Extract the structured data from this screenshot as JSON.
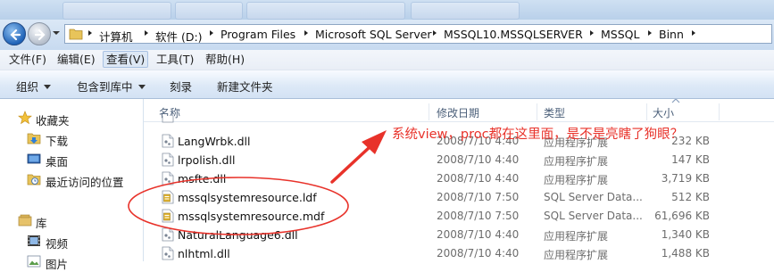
{
  "address": {
    "segments": [
      "计算机",
      "软件 (D:)",
      "Program Files",
      "Microsoft SQL Server",
      "MSSQL10.MSSQLSERVER",
      "MSSQL",
      "Binn"
    ]
  },
  "menu": [
    "文件(F)",
    "编辑(E)",
    "查看(V)",
    "工具(T)",
    "帮助(H)"
  ],
  "menu_active": "查看(V)",
  "toolbar": {
    "organize": "组织",
    "include_library": "包含到库中",
    "burn": "刻录",
    "new_folder": "新建文件夹"
  },
  "nav": {
    "favorites": "收藏夹",
    "downloads": "下载",
    "desktop": "桌面",
    "recent": "最近访问的位置",
    "libraries": "库",
    "videos": "视频",
    "pictures": "图片"
  },
  "columns": {
    "name": "名称",
    "modified": "修改日期",
    "type": "类型",
    "size": "大小"
  },
  "files": [
    {
      "name": "LangWrbk.dll",
      "date": "2008/7/10 4:40",
      "type": "应用程序扩展",
      "size": "232 KB",
      "icon": "dll-file-icon"
    },
    {
      "name": "lrpolish.dll",
      "date": "2008/7/10 4:40",
      "type": "应用程序扩展",
      "size": "147 KB",
      "icon": "dll-file-icon"
    },
    {
      "name": "msfte.dll",
      "date": "2008/7/10 4:40",
      "type": "应用程序扩展",
      "size": "3,719 KB",
      "icon": "dll-file-icon"
    },
    {
      "name": "mssqlsystemresource.ldf",
      "date": "2008/7/10 7:50",
      "type": "SQL Server Data...",
      "size": "512 KB",
      "icon": "sql-data-file-icon"
    },
    {
      "name": "mssqlsystemresource.mdf",
      "date": "2008/7/10 7:50",
      "type": "SQL Server Data...",
      "size": "61,696 KB",
      "icon": "sql-data-file-icon"
    },
    {
      "name": "NaturalLanguage6.dll",
      "date": "2008/7/10 4:40",
      "type": "应用程序扩展",
      "size": "1,340 KB",
      "icon": "dll-file-icon"
    },
    {
      "name": "nlhtml.dll",
      "date": "2008/7/10 4:40",
      "type": "应用程序扩展",
      "size": "1,488 KB",
      "icon": "dll-file-icon"
    }
  ],
  "annotation": {
    "text": "系统view，proc都在这里面，是不是亮瞎了狗眼？",
    "color": "#e8322a"
  }
}
